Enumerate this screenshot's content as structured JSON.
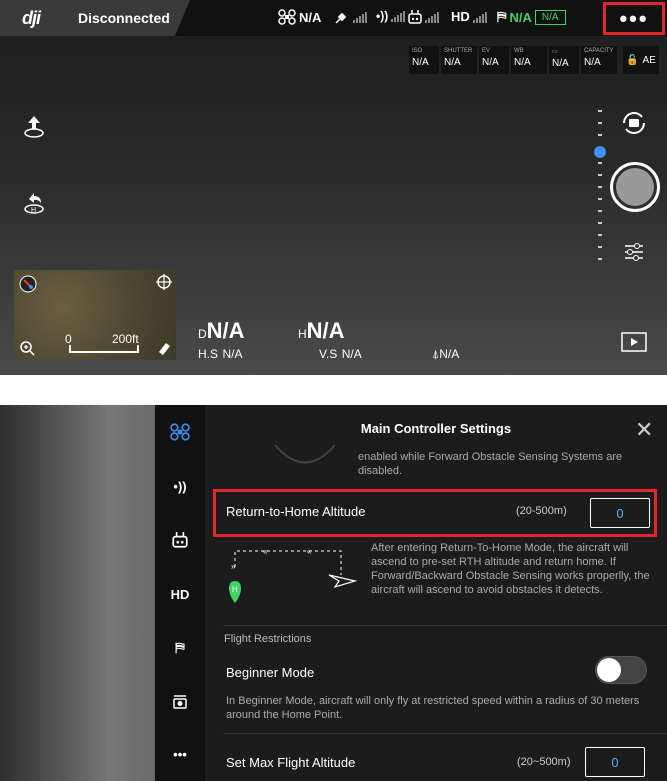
{
  "status_bar": {
    "logo": "dji",
    "connection": "Disconnected",
    "aircraft_status": "N/A",
    "hd_label": "HD",
    "flight_mode_value": "N/A",
    "flight_mode_box": "N/A",
    "more_label": "•••"
  },
  "camera_params": [
    {
      "label": "ISO",
      "value": "N/A"
    },
    {
      "label": "SHUTTER",
      "value": "N/A"
    },
    {
      "label": "EV",
      "value": "N/A"
    },
    {
      "label": "WB",
      "value": "N/A"
    },
    {
      "label": "",
      "value": "N/A"
    },
    {
      "label": "CAPACITY",
      "value": "N/A"
    }
  ],
  "ae_label": "AE",
  "map": {
    "scale_start": "0",
    "scale_end": "200ft"
  },
  "telemetry": {
    "d_key": "D",
    "d_value": "N/A",
    "h_key": "H",
    "h_value": "N/A",
    "hs_key": "H.S",
    "hs_value": "N/A",
    "vs_key": "V.S",
    "vs_value": "N/A",
    "dist_value": "N/A"
  },
  "settings": {
    "title": "Main Controller Settings",
    "obstacle_note": "enabled while Forward Obstacle Sensing Systems are disabled.",
    "rth_label": "Return-to-Home Altitude",
    "rth_range": "(20-500m)",
    "rth_value": "0",
    "rth_description": "After entering Return-To-Home Mode, the aircraft will ascend to pre-set RTH altitude and return home. If Forward/Backward Obstacle Sensing works properlly, the aircraft will ascend to avoid obstacles it detects.",
    "home_marker": "H",
    "section_flight_restrictions": "Flight Restrictions",
    "beginner_label": "Beginner Mode",
    "beginner_description": "In Beginner Mode, aircraft will only fly at restricted speed within a radius of 30 meters around the Home Point.",
    "max_alt_label": "Set Max Flight Altitude",
    "max_alt_range": "(20~500m)",
    "max_alt_value": "0"
  },
  "side_menu": {
    "hd_label": "HD",
    "more_label": "•••"
  }
}
